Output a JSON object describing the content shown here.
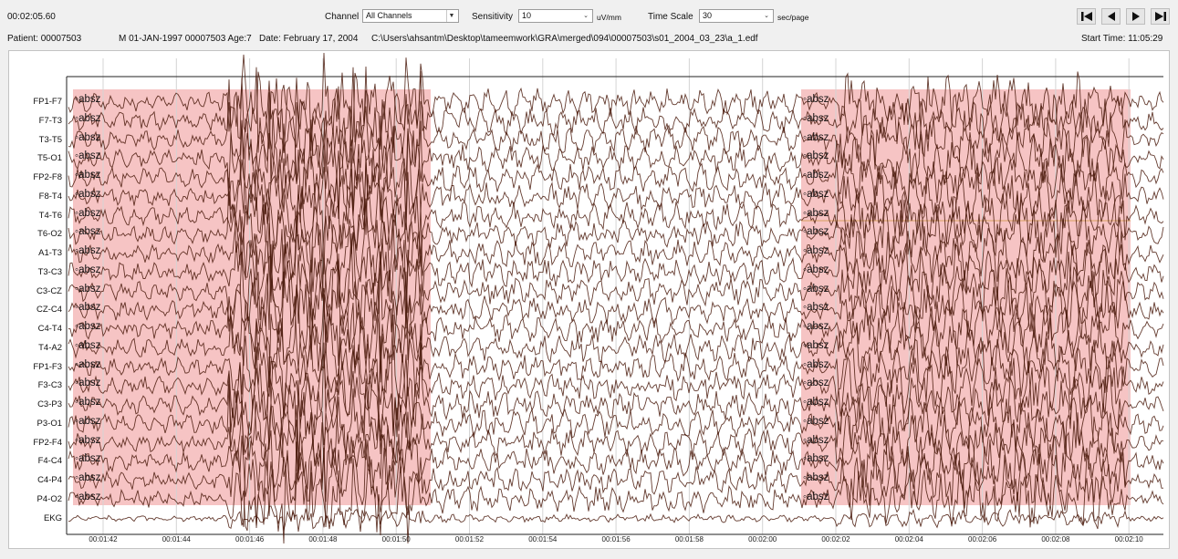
{
  "header": {
    "elapsed": "00:02:05.60",
    "channel_label": "Channel",
    "channel_value": "All Channels",
    "sensitivity_label": "Sensitivity",
    "sensitivity_value": "10",
    "sensitivity_unit": "uV/mm",
    "timescale_label": "Time Scale",
    "timescale_value": "30",
    "timescale_unit": "sec/page",
    "nav_icons": [
      "skip-to-start-icon",
      "previous-page-icon",
      "next-page-icon",
      "skip-to-end-icon"
    ]
  },
  "info": {
    "patient": "Patient: 00007503",
    "details": "M 01-JAN-1997 00007503 Age:7",
    "date": "Date: February 17, 2004",
    "path": "C:\\Users\\ahsantm\\Desktop\\tameemwork\\GRA\\merged\\094\\00007503\\s01_2004_03_23\\a_1.edf",
    "start_time": "Start Time: 11:05:29"
  },
  "channels": [
    "FP1-F7",
    "F7-T3",
    "T3-T5",
    "T5-O1",
    "FP2-F8",
    "F8-T4",
    "T4-T6",
    "T6-O2",
    "A1-T3",
    "T3-C3",
    "C3-CZ",
    "CZ-C4",
    "C4-T4",
    "T4-A2",
    "FP1-F3",
    "F3-C3",
    "C3-P3",
    "P3-O1",
    "FP2-F4",
    "F4-C4",
    "C4-P4",
    "P4-O2",
    "EKG"
  ],
  "annotation_label": "absz",
  "highlight_color": "#f6c4c4",
  "trace_color": "#4a1a0c",
  "time_ticks": [
    "00:01:42",
    "00:01:44",
    "00:01:46",
    "00:01:48",
    "00:01:50",
    "00:01:52",
    "00:01:54",
    "00:01:56",
    "00:01:58",
    "00:02:00",
    "00:02:02",
    "00:02:04",
    "00:02:06",
    "00:02:08",
    "00:02:10"
  ]
}
